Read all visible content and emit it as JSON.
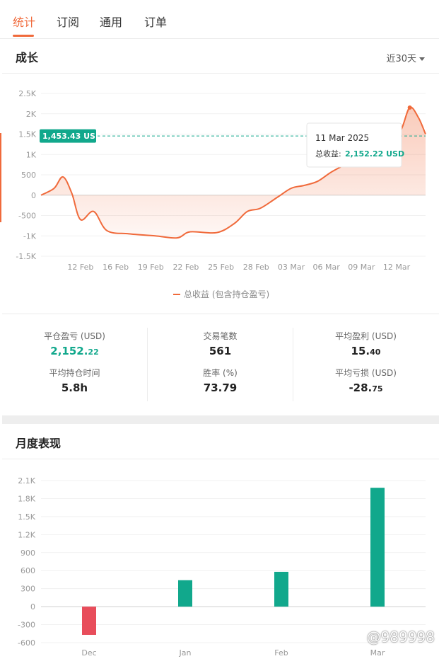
{
  "tabs": [
    {
      "label": "统计",
      "active": true
    },
    {
      "label": "订阅",
      "active": false
    },
    {
      "label": "通用",
      "active": false
    },
    {
      "label": "订单",
      "active": false
    }
  ],
  "growth": {
    "title": "成长",
    "range_label": "近30天",
    "legend_label": "总收益 (包含持仓盈亏)",
    "marker_label": "1,453.43 USD",
    "tooltip": {
      "date": "11 Mar 2025",
      "label": "总收益:",
      "value": "2,152.22 USD"
    }
  },
  "stats": [
    {
      "label": "平仓盈亏 (USD)",
      "int": "2,152.",
      "dec": "22",
      "green": true
    },
    {
      "label": "交易笔数",
      "int": "561",
      "dec": "",
      "green": false
    },
    {
      "label": "平均盈利 (USD)",
      "int": "15.",
      "dec": "40",
      "green": false
    },
    {
      "label": "平均持仓时间",
      "int": "5.8h",
      "dec": "",
      "green": false
    },
    {
      "label": "胜率 (%)",
      "int": "73.79",
      "dec": "",
      "green": false
    },
    {
      "label": "平均亏损 (USD)",
      "int": "-28.",
      "dec": "75",
      "green": false
    }
  ],
  "monthly": {
    "title": "月度表现"
  },
  "watermark": "@989998",
  "colors": {
    "accent": "#f06a3b",
    "green": "#11a88c",
    "red": "#e84d5b"
  },
  "chart_data": [
    {
      "type": "area",
      "title": "",
      "series": [
        {
          "name": "总收益 (包含持仓盈亏)"
        }
      ],
      "x_tick_labels": [
        "12 Feb",
        "16 Feb",
        "19 Feb",
        "22 Feb",
        "25 Feb",
        "28 Feb",
        "03 Mar",
        "06 Mar",
        "09 Mar",
        "12 Mar"
      ],
      "y_tick_labels": [
        "2.5K",
        "2K",
        "1.5K",
        "1K",
        "500",
        "0",
        "-500",
        "-1K",
        "-1.5K"
      ],
      "ylim": [
        -1500,
        2500
      ],
      "reference_line": 1453.43,
      "points": [
        {
          "t": 0,
          "y": 0
        },
        {
          "t": 1.5,
          "y": 170
        },
        {
          "t": 2.5,
          "y": 450
        },
        {
          "t": 3.5,
          "y": 50
        },
        {
          "t": 4.5,
          "y": -600
        },
        {
          "t": 6,
          "y": -400
        },
        {
          "t": 7.5,
          "y": -870
        },
        {
          "t": 10,
          "y": -950
        },
        {
          "t": 13,
          "y": -1000
        },
        {
          "t": 15.5,
          "y": -1050
        },
        {
          "t": 17,
          "y": -900
        },
        {
          "t": 20,
          "y": -920
        },
        {
          "t": 22,
          "y": -700
        },
        {
          "t": 23.5,
          "y": -400
        },
        {
          "t": 25,
          "y": -320
        },
        {
          "t": 27,
          "y": -40
        },
        {
          "t": 28.5,
          "y": 170
        },
        {
          "t": 30,
          "y": 240
        },
        {
          "t": 31.5,
          "y": 340
        },
        {
          "t": 33,
          "y": 560
        },
        {
          "t": 34.5,
          "y": 740
        },
        {
          "t": 35.5,
          "y": 900
        },
        {
          "t": 36.5,
          "y": 700
        },
        {
          "t": 37.5,
          "y": 860
        },
        {
          "t": 39.5,
          "y": 1150
        },
        {
          "t": 41,
          "y": 1600
        },
        {
          "t": 42,
          "y": 2152.22
        },
        {
          "t": 43,
          "y": 1900
        },
        {
          "t": 43.8,
          "y": 1500
        }
      ],
      "x_tick_t": [
        4.5,
        8.5,
        12.5,
        16.5,
        20.5,
        24.5,
        28.5,
        32.5,
        36.5,
        40.5
      ],
      "grid": true
    },
    {
      "type": "bar",
      "title": "",
      "categories": [
        "Dec",
        "Jan",
        "Feb",
        "Mar"
      ],
      "values": [
        -470,
        440,
        580,
        1980
      ],
      "y_tick_labels": [
        "2.1K",
        "1.8K",
        "1.5K",
        "1.2K",
        "900",
        "600",
        "300",
        "0",
        "-300",
        "-600"
      ],
      "ylim": [
        -600,
        2100
      ],
      "grid": true
    }
  ]
}
